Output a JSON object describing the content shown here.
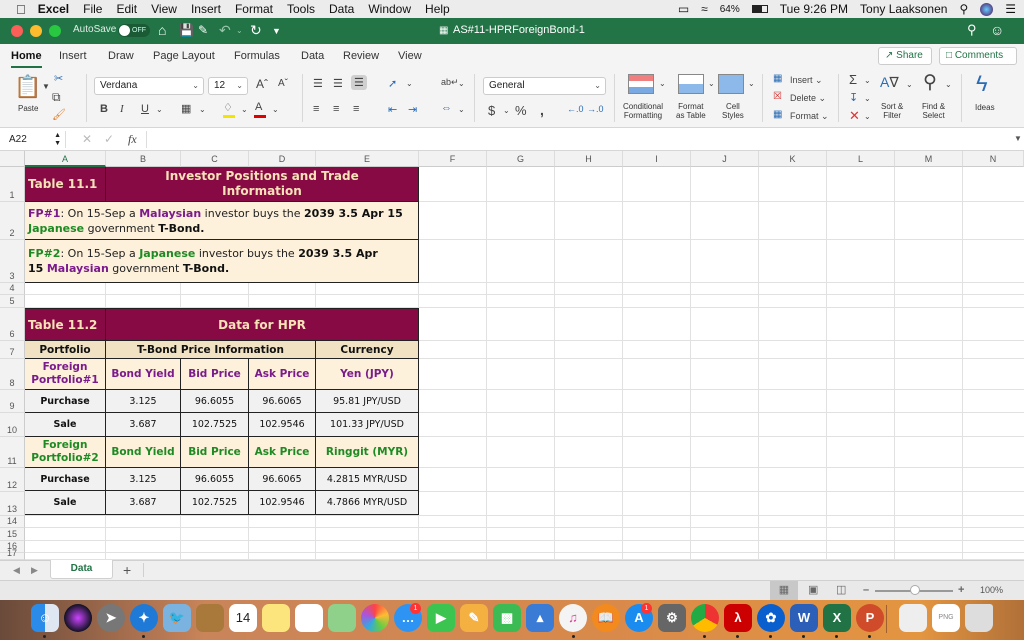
{
  "menubar": {
    "app": "Excel",
    "items": [
      "File",
      "Edit",
      "View",
      "Insert",
      "Format",
      "Tools",
      "Data",
      "Window",
      "Help"
    ],
    "battery": "64%",
    "clock": "Tue 9:26 PM",
    "user": "Tony Laaksonen"
  },
  "titlebar": {
    "autosave_label": "AutoSave",
    "autosave_state": "OFF",
    "document_title": "AS#11-HPRForeignBond-1"
  },
  "ribbon_tabs": [
    "Home",
    "Insert",
    "Draw",
    "Page Layout",
    "Formulas",
    "Data",
    "Review",
    "View"
  ],
  "active_tab": "Home",
  "share_label": "Share",
  "comments_label": "Comments",
  "ribbon": {
    "paste_label": "Paste",
    "font_name": "Verdana",
    "font_size": "12",
    "number_format": "General",
    "conditional_formatting": "Conditional Formatting",
    "conditional_l1": "Conditional",
    "conditional_l2": "Formatting",
    "format_table_l1": "Format",
    "format_table_l2": "as Table",
    "cell_styles_l1": "Cell",
    "cell_styles_l2": "Styles",
    "insert_label": "Insert",
    "delete_label": "Delete",
    "format_label": "Format",
    "sort_l1": "Sort &",
    "sort_l2": "Filter",
    "find_l1": "Find &",
    "find_l2": "Select",
    "ideas_label": "Ideas",
    "fill_color": "#f5e400",
    "font_color": "#e00000"
  },
  "formula_bar": {
    "name_box": "A22",
    "fx": "fx",
    "content": ""
  },
  "columns": [
    "A",
    "B",
    "C",
    "D",
    "E",
    "F",
    "G",
    "H",
    "I",
    "J",
    "K",
    "L",
    "M",
    "N"
  ],
  "rows": [
    "1",
    "2",
    "3",
    "4",
    "5",
    "6",
    "7",
    "8",
    "9",
    "10",
    "11",
    "12",
    "13",
    "14",
    "15",
    "16",
    "17"
  ],
  "table1": {
    "label": "Table 11.1",
    "title": "Investor Positions and Trade Information",
    "fp1": {
      "tag": "FP#1",
      "t1": ": On 15-Sep a ",
      "nationality": "Malaysian",
      "t2": " investor buys the ",
      "bond": "2039 3.5 Apr 15",
      "country": "Japanese",
      "t3": " government ",
      "type": "T-Bond."
    },
    "fp2": {
      "tag": "FP#2",
      "t1": ": On 15-Sep a ",
      "nationality": "Japanese",
      "t2": " investor buys the ",
      "bond1": "2039 3.5 Apr",
      "bond2": "15",
      "country": "Malaysian",
      "t3": " government ",
      "type": "T-Bond."
    }
  },
  "table2": {
    "label": "Table 11.2",
    "title": "Data for HPR",
    "headers": {
      "portfolio": "Portfolio",
      "tbond": "T-Bond Price Information",
      "currency": "Currency"
    },
    "portfolio1": {
      "name": "Foreign Portfolio#1",
      "cols": [
        "Bond Yield",
        "Bid Price",
        "Ask Price",
        "Yen (JPY)"
      ],
      "rows": [
        {
          "label": "Purchase",
          "yield": "3.125",
          "bid": "96.6055",
          "ask": "96.6065",
          "fx": "95.81 JPY/USD"
        },
        {
          "label": "Sale",
          "yield": "3.687",
          "bid": "102.7525",
          "ask": "102.9546",
          "fx": "101.33 JPY/USD"
        }
      ]
    },
    "portfolio2": {
      "name": "Foreign Portfolio#2",
      "cols": [
        "Bond Yield",
        "Bid Price",
        "Ask Price",
        "Ringgit (MYR)"
      ],
      "rows": [
        {
          "label": "Purchase",
          "yield": "3.125",
          "bid": "96.6055",
          "ask": "96.6065",
          "fx": "4.2815 MYR/USD"
        },
        {
          "label": "Sale",
          "yield": "3.687",
          "bid": "102.7525",
          "ask": "102.9546",
          "fx": "4.7866 MYR/USD"
        }
      ]
    }
  },
  "sheet_tabs": [
    "Data"
  ],
  "status": {
    "zoom": "100%"
  },
  "dock": {
    "calendar_day": "14",
    "messages_badge": "1",
    "appstore_badge": "1"
  }
}
